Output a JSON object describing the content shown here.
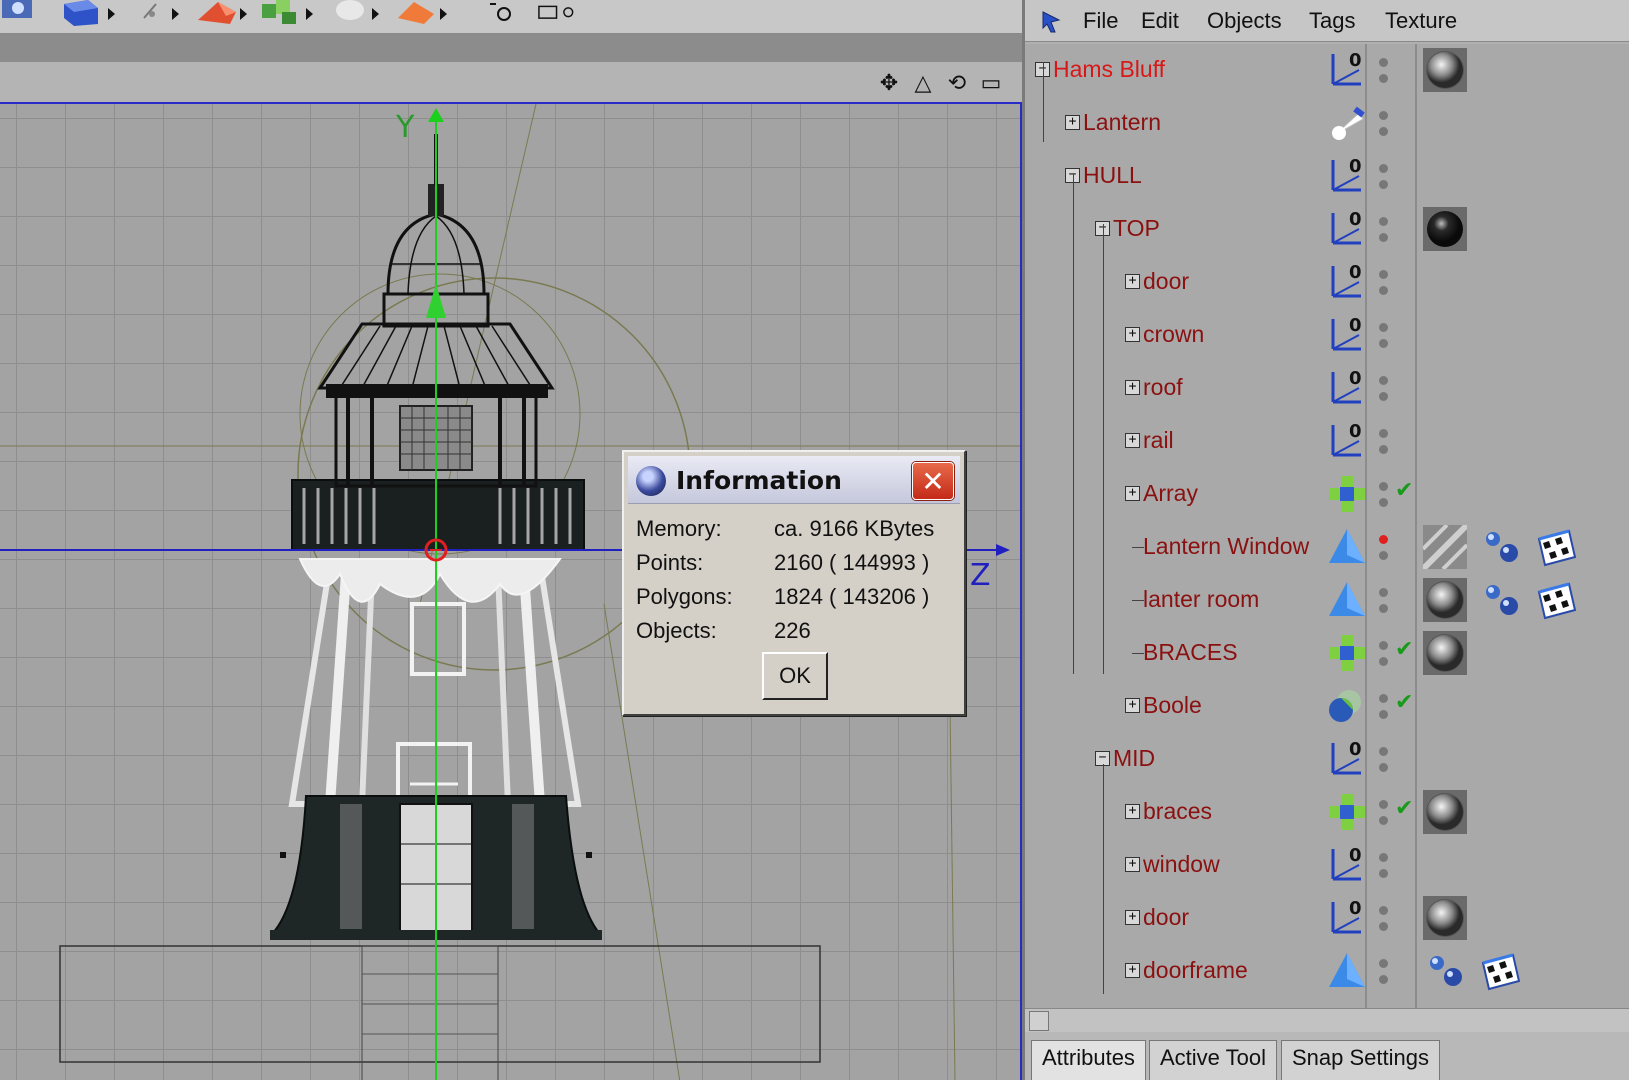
{
  "menu": {
    "file": "File",
    "edit": "Edit",
    "objects": "Objects",
    "tags": "Tags",
    "texture": "Texture"
  },
  "viewport": {
    "axis_y": "Y",
    "axis_z": "Z"
  },
  "dialog": {
    "title": "Information",
    "rows": [
      {
        "key": "Memory:",
        "value": "ca. 9166 KBytes"
      },
      {
        "key": "Points:",
        "value": "2160 ( 144993 )"
      },
      {
        "key": "Polygons:",
        "value": "1824 ( 143206 )"
      },
      {
        "key": "Objects:",
        "value": "226"
      }
    ],
    "ok": "OK"
  },
  "objects": [
    {
      "label": "Hams Bluff",
      "depth": 0,
      "expander": "minus",
      "icon": "null-axis",
      "tags": [
        "material-sphere"
      ]
    },
    {
      "label": "Lantern",
      "depth": 1,
      "expander": "plus",
      "icon": "spotlight",
      "tags": []
    },
    {
      "label": "HULL",
      "depth": 1,
      "expander": "minus",
      "icon": "null-axis",
      "tags": []
    },
    {
      "label": "TOP",
      "depth": 2,
      "expander": "minus",
      "icon": "null-axis",
      "tags": [
        "material-sphere-dark"
      ]
    },
    {
      "label": "door",
      "depth": 3,
      "expander": "plus",
      "icon": "null-axis",
      "tags": []
    },
    {
      "label": "crown",
      "depth": 3,
      "expander": "plus",
      "icon": "null-axis",
      "tags": []
    },
    {
      "label": "roof",
      "depth": 3,
      "expander": "plus",
      "icon": "null-axis",
      "tags": []
    },
    {
      "label": "rail",
      "depth": 3,
      "expander": "plus",
      "icon": "null-axis",
      "tags": []
    },
    {
      "label": "Array",
      "depth": 3,
      "expander": "plus",
      "icon": "array",
      "check": true,
      "tags": []
    },
    {
      "label": "Lantern Window",
      "depth": 3,
      "expander": "none",
      "icon": "polygon",
      "red_dot": true,
      "tags": [
        "material-flat",
        "uvw-tag",
        "texture-tag"
      ]
    },
    {
      "label": "lanter room",
      "depth": 3,
      "expander": "none",
      "icon": "polygon",
      "tags": [
        "material-sphere",
        "uvw-tag",
        "texture-tag"
      ]
    },
    {
      "label": "BRACES",
      "depth": 3,
      "expander": "none",
      "icon": "array",
      "check": true,
      "tags": [
        "material-sphere"
      ]
    },
    {
      "label": "Boole",
      "depth": 3,
      "expander": "plus",
      "icon": "boole",
      "check": true,
      "tags": []
    },
    {
      "label": "MID",
      "depth": 2,
      "expander": "minus",
      "icon": "null-axis",
      "tags": []
    },
    {
      "label": "braces",
      "depth": 3,
      "expander": "plus",
      "icon": "array",
      "check": true,
      "tags": [
        "material-sphere"
      ]
    },
    {
      "label": "window",
      "depth": 3,
      "expander": "plus",
      "icon": "null-axis",
      "tags": []
    },
    {
      "label": "door",
      "depth": 3,
      "expander": "plus",
      "icon": "null-axis",
      "tags": [
        "material-sphere"
      ]
    },
    {
      "label": "doorframe",
      "depth": 3,
      "expander": "plus",
      "icon": "polygon",
      "tags": [
        "uvw-tag",
        "texture-tag"
      ]
    }
  ],
  "tabs": [
    "Attributes",
    "Active Tool",
    "Snap Settings"
  ]
}
